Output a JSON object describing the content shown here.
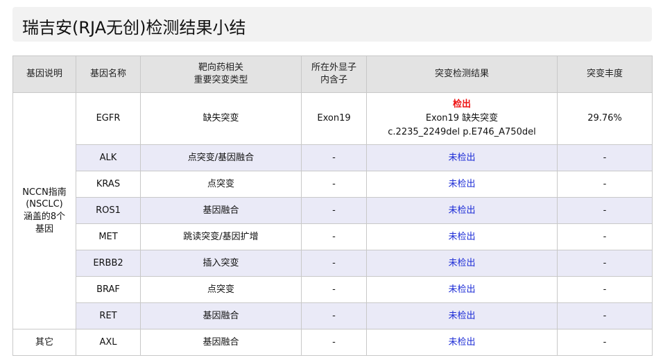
{
  "title": "瑞吉安(RJA无创)检测结果小结",
  "headers": {
    "gene_desc": "基因说明",
    "gene_name": "基因名称",
    "target_line1": "靶向药相关",
    "target_line2": "重要突变类型",
    "exon_line1": "所在外显子",
    "exon_line2": "内含子",
    "result": "突变检测结果",
    "abundance": "突变丰度"
  },
  "groups": {
    "nccn_line1": "NCCN指南",
    "nccn_line2": "(NSCLC)",
    "nccn_line3": "涵盖的8个",
    "nccn_line4": "基因",
    "other": "其它"
  },
  "egfr": {
    "gene": "EGFR",
    "type": "缺失突变",
    "exon": "Exon19",
    "status": "检出",
    "detail1": "Exon19 缺失突变",
    "detail2": "c.2235_2249del p.E746_A750del",
    "abundance": "29.76%"
  },
  "rows": [
    {
      "gene": "ALK",
      "type": "点突变/基因融合",
      "exon": "-",
      "result": "未检出",
      "abundance": "-"
    },
    {
      "gene": "KRAS",
      "type": "点突变",
      "exon": "-",
      "result": "未检出",
      "abundance": "-"
    },
    {
      "gene": "ROS1",
      "type": "基因融合",
      "exon": "-",
      "result": "未检出",
      "abundance": "-"
    },
    {
      "gene": "MET",
      "type": "跳读突变/基因扩增",
      "exon": "-",
      "result": "未检出",
      "abundance": "-"
    },
    {
      "gene": "ERBB2",
      "type": "插入突变",
      "exon": "-",
      "result": "未检出",
      "abundance": "-"
    },
    {
      "gene": "BRAF",
      "type": "点突变",
      "exon": "-",
      "result": "未检出",
      "abundance": "-"
    },
    {
      "gene": "RET",
      "type": "基因融合",
      "exon": "-",
      "result": "未检出",
      "abundance": "-"
    },
    {
      "gene": "AXL",
      "type": "基因融合",
      "exon": "-",
      "result": "未检出",
      "abundance": "-"
    }
  ],
  "colors": {
    "detected": "#ee1111",
    "not_detected": "#1b2bd6",
    "header_bg": "#e3e3e3",
    "row_shade": "#eaeaf7",
    "title_bg": "#f2f2f2"
  }
}
